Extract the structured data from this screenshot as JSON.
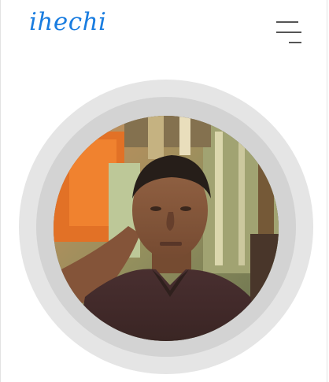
{
  "header": {
    "brand": "ihechi",
    "menu_icon": "hamburger-menu-icon"
  },
  "profile": {
    "photo_icon": "profile-photo"
  },
  "colors": {
    "brand": "#1a7de0",
    "ring_outer": "#e5e5e5",
    "ring_inner": "#d3d3d3",
    "menu_lines": "#555555"
  }
}
